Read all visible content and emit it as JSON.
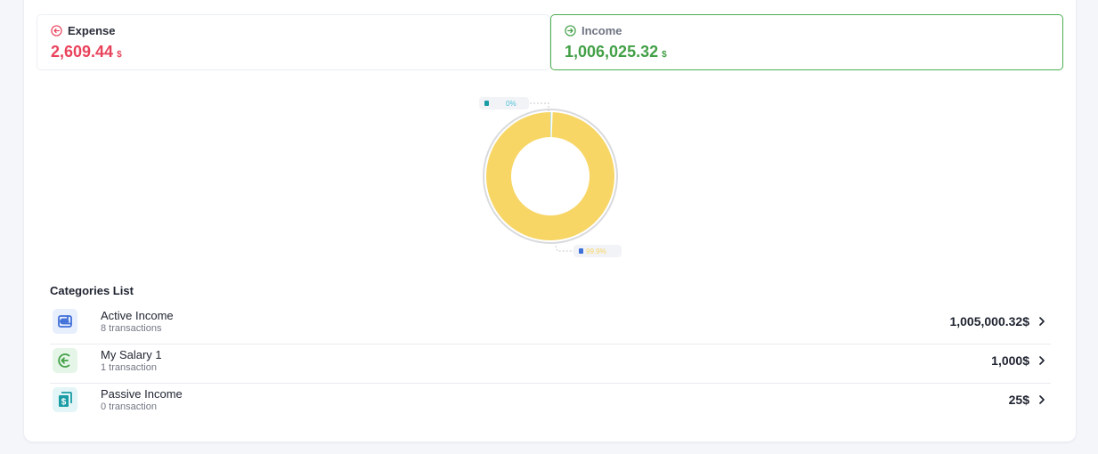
{
  "tabs": {
    "expense": {
      "label": "Expense",
      "amount": "2,609.44",
      "currency": "$"
    },
    "income": {
      "label": "Income",
      "amount": "1,006,025.32",
      "currency": "$"
    }
  },
  "chart_data": {
    "type": "pie",
    "variant": "donut",
    "slices": [
      {
        "label": "0%",
        "value": 0.1,
        "color": "#4fc3d9"
      },
      {
        "label": "99.9%",
        "value": 99.9,
        "color": "#f7d666"
      }
    ]
  },
  "categories": {
    "title": "Categories List",
    "items": [
      {
        "name": "Active Income",
        "sub": "8 transactions",
        "amount": "1,005,000.32$",
        "icon": "wallet-icon",
        "color": "#3f6fd8",
        "bg": "#e8effc"
      },
      {
        "name": "My Salary 1",
        "sub": "1 transaction",
        "amount": "1,000$",
        "icon": "income-arrow-icon",
        "color": "#43a047",
        "bg": "#e5f6e8"
      },
      {
        "name": "Passive Income",
        "sub": "0 transaction",
        "amount": "25$",
        "icon": "cash-icon",
        "color": "#1a9ca6",
        "bg": "#e3f5f6"
      }
    ]
  }
}
